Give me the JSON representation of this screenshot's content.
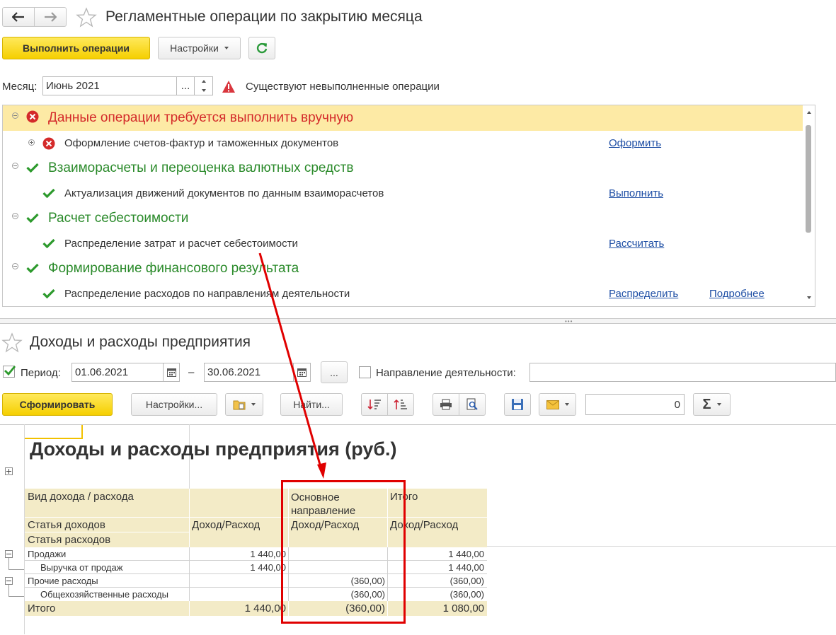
{
  "top": {
    "title": "Регламентные операции по закрытию месяца",
    "run_button": "Выполнить операции",
    "settings_button": "Настройки",
    "month_label": "Месяц:",
    "month_value": "Июнь 2021",
    "ellipsis": "...",
    "warning_text": "Существуют невыполненные операции"
  },
  "operations": {
    "g1": {
      "title": "Данные операции требуется выполнить вручную",
      "item": "Оформление счетов-фактур и таможенных документов",
      "link": "Оформить"
    },
    "g2": {
      "title": "Взаиморасчеты и переоценка валютных средств",
      "item": "Актуализация движений документов по данным взаиморасчетов",
      "link": "Выполнить"
    },
    "g3": {
      "title": "Расчет себестоимости",
      "item": "Распределение затрат и расчет себестоимости",
      "link": "Рассчитать"
    },
    "g4": {
      "title": "Формирование финансового результата",
      "item": "Распределение расходов по направлениям деятельности",
      "link": "Распределить",
      "link2": "Подробнее"
    }
  },
  "report": {
    "title": "Доходы и расходы предприятия",
    "period_label": "Период:",
    "date_from": "01.06.2021",
    "dash": "–",
    "date_to": "30.06.2021",
    "ellipsis": "...",
    "direction_label": "Направление деятельности:",
    "form_button": "Сформировать",
    "settings_button": "Настройки...",
    "find_button": "Найти...",
    "sum_value": "0",
    "sigma": "Σ",
    "heading": "Доходы и расходы предприятия (руб.)"
  },
  "table": {
    "h_kind": "Вид дохода / расхода",
    "h_main": "Основное направление",
    "h_total": "Итого",
    "h_income_article": "Статья доходов",
    "h_expense_article": "Статья расходов",
    "h_dr1": "Доход/Расход",
    "h_dr2": "Доход/Расход",
    "h_dr3": "Доход/Расход",
    "rows": [
      {
        "name": "Продажи",
        "a": "1 440,00",
        "b": "",
        "c": "1 440,00"
      },
      {
        "name": "Выручка от продаж",
        "a": "1 440,00",
        "b": "",
        "c": "1 440,00"
      },
      {
        "name": "Прочие расходы",
        "a": "",
        "b": "(360,00)",
        "c": "(360,00)"
      },
      {
        "name": "Общехозяйственные расходы",
        "a": "",
        "b": "(360,00)",
        "c": "(360,00)"
      }
    ],
    "total": {
      "name": "Итого",
      "a": "1 440,00",
      "b": "(360,00)",
      "c": "1 080,00"
    }
  },
  "colors": {
    "accent_yellow": "#f5cf00",
    "error_red": "#d42a2a",
    "ok_green": "#2d9a2d",
    "link": "#1f4fa5",
    "highlight_row": "#fdeaa5",
    "annotation_red": "#e00000"
  }
}
